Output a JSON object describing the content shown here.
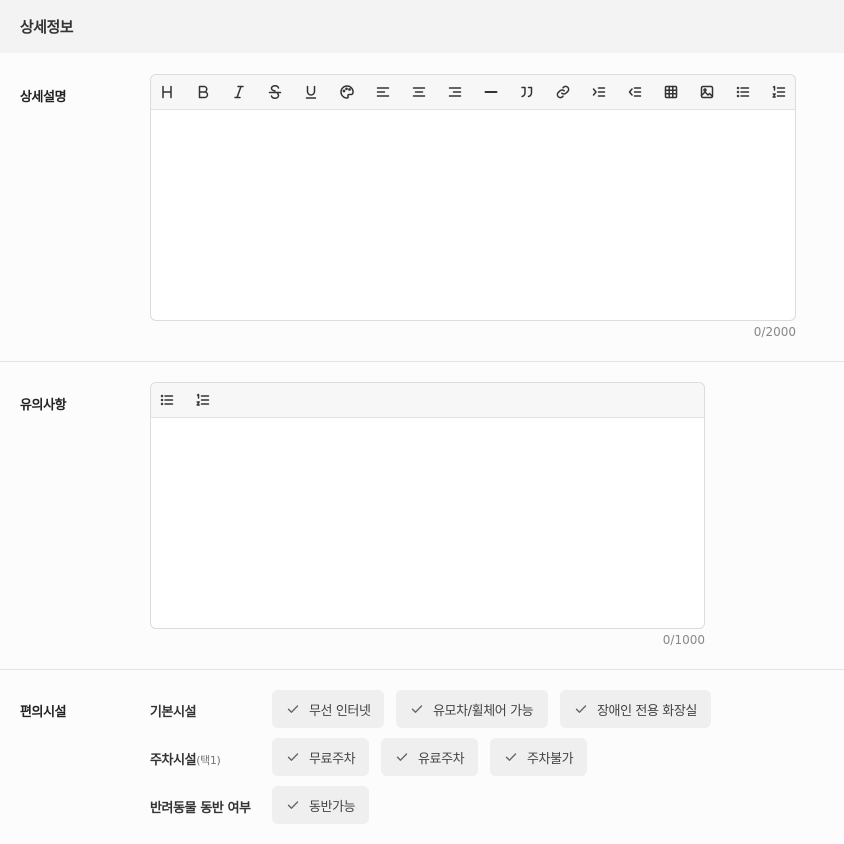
{
  "header": {
    "title": "상세정보"
  },
  "detail": {
    "label": "상세설명",
    "toolbar": [
      "heading-icon",
      "bold-icon",
      "italic-icon",
      "strikethrough-icon",
      "underline-icon",
      "palette-icon",
      "align-left-icon",
      "align-center-icon",
      "align-right-icon",
      "horizontal-rule-icon",
      "quote-icon",
      "link-icon",
      "indent-icon",
      "outdent-icon",
      "table-icon",
      "image-icon",
      "bullet-list-icon",
      "ordered-list-icon"
    ],
    "counter": "0/2000"
  },
  "notes": {
    "label": "유의사항",
    "toolbar": [
      "bullet-list-icon",
      "ordered-list-icon"
    ],
    "counter": "0/1000"
  },
  "amenities": {
    "label": "편의시설",
    "basic": {
      "label": "기본시설",
      "options": [
        "무선 인터넷",
        "유모차/휠체어 가능",
        "장애인 전용 화장실"
      ]
    },
    "parking": {
      "label": "주차시설",
      "note": "(택1)",
      "options": [
        "무료주차",
        "유료주차",
        "주차불가"
      ]
    },
    "pets": {
      "label": "반려동물 동반 여부",
      "options": [
        "동반가능"
      ]
    }
  }
}
